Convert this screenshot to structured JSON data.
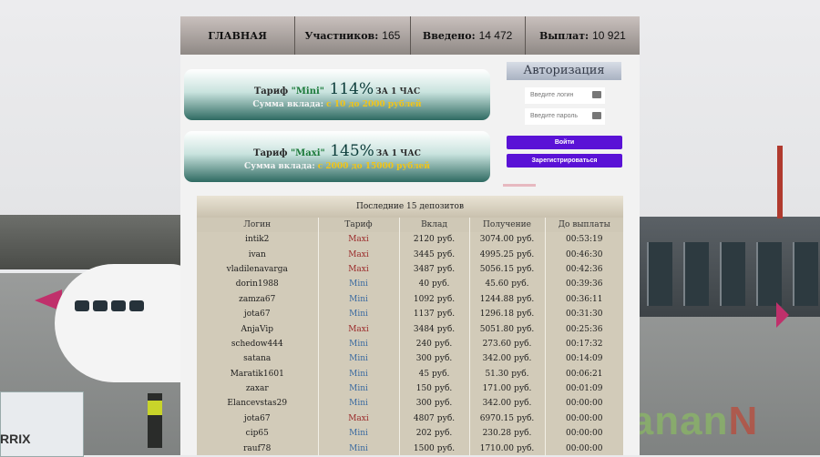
{
  "nav": [
    {
      "label": "ГЛАВНАЯ",
      "value": ""
    },
    {
      "label": "Участников:",
      "value": "165"
    },
    {
      "label": "Введено:",
      "value": "14 472"
    },
    {
      "label": "Выплат:",
      "value": "10 921"
    }
  ],
  "tariffs": [
    {
      "prefix": "Тариф",
      "name": "\"Mini\"",
      "pct": "114%",
      "per": "ЗА 1 ЧАС",
      "sum_label": "Сумма вклада:",
      "range": "с 10 до 2000 рублей"
    },
    {
      "prefix": "Тариф",
      "name": "\"Maxi\"",
      "pct": "145%",
      "per": "ЗА 1 ЧАС",
      "sum_label": "Сумма вклада:",
      "range": "с 2000 до 15000 рублей"
    }
  ],
  "auth": {
    "title": "Авторизация",
    "login_placeholder": "Введите логин",
    "password_placeholder": "Введите пароль",
    "login_button": "Войти",
    "register_button": "Зарегистрироваться"
  },
  "deposits": {
    "title": "Последние 15 депозитов",
    "columns": [
      "Логин",
      "Тариф",
      "Вклад",
      "Получение",
      "До выплаты"
    ],
    "rows": [
      {
        "login": "intik2",
        "tariff": "Maxi",
        "deposit": "2120",
        "payout": "3074.00",
        "time": "00:53:19"
      },
      {
        "login": "ivan",
        "tariff": "Maxi",
        "deposit": "3445",
        "payout": "4995.25",
        "time": "00:46:30"
      },
      {
        "login": "vladilenavarga",
        "tariff": "Maxi",
        "deposit": "3487",
        "payout": "5056.15",
        "time": "00:42:36"
      },
      {
        "login": "dorin1988",
        "tariff": "Mini",
        "deposit": "40",
        "payout": "45.60",
        "time": "00:39:36"
      },
      {
        "login": "zamza67",
        "tariff": "Mini",
        "deposit": "1092",
        "payout": "1244.88",
        "time": "00:36:11"
      },
      {
        "login": "jota67",
        "tariff": "Mini",
        "deposit": "1137",
        "payout": "1296.18",
        "time": "00:31:30"
      },
      {
        "login": "AnjaVip",
        "tariff": "Maxi",
        "deposit": "3484",
        "payout": "5051.80",
        "time": "00:25:36"
      },
      {
        "login": "schedow444",
        "tariff": "Mini",
        "deposit": "240",
        "payout": "273.60",
        "time": "00:17:32"
      },
      {
        "login": "satana",
        "tariff": "Mini",
        "deposit": "300",
        "payout": "342.00",
        "time": "00:14:09"
      },
      {
        "login": "Maratik1601",
        "tariff": "Mini",
        "deposit": "45",
        "payout": "51.30",
        "time": "00:06:21"
      },
      {
        "login": "zaxar",
        "tariff": "Mini",
        "deposit": "150",
        "payout": "171.00",
        "time": "00:01:09"
      },
      {
        "login": "Elancevstas29",
        "tariff": "Mini",
        "deposit": "300",
        "payout": "342.00",
        "time": "00:00:00"
      },
      {
        "login": "jota67",
        "tariff": "Maxi",
        "deposit": "4807",
        "payout": "6970.15",
        "time": "00:00:00"
      },
      {
        "login": "cip65",
        "tariff": "Mini",
        "deposit": "202",
        "payout": "230.28",
        "time": "00:00:00"
      },
      {
        "login": "rauf78",
        "tariff": "Mini",
        "deposit": "1500",
        "payout": "1710.00",
        "time": "00:00:00"
      }
    ],
    "currency": "руб."
  },
  "background": {
    "truck_label": "RRIX",
    "watermark": "Banan",
    "watermark_end": "N"
  }
}
